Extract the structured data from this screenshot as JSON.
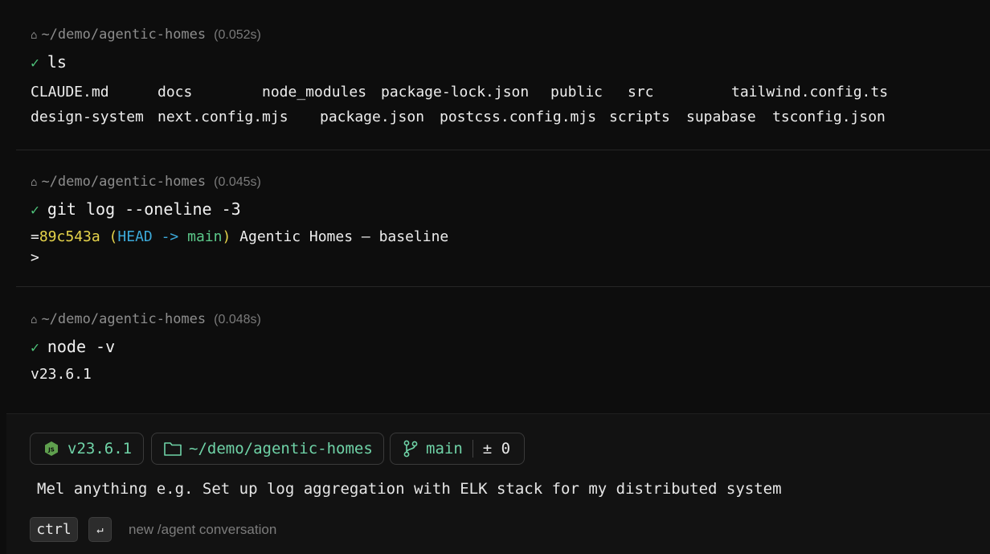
{
  "blocks": [
    {
      "path": "~/demo/agentic-homes",
      "time": "(0.052s)",
      "command": "ls",
      "ls_rows": [
        [
          "CLAUDE.md",
          "docs",
          "node_modules",
          "package-lock.json",
          "public",
          "src",
          "tailwind.config.ts"
        ],
        [
          "design-system",
          "next.config.mjs",
          "package.json",
          "postcss.config.mjs",
          "scripts",
          "supabase",
          "tsconfig.json"
        ]
      ]
    },
    {
      "path": "~/demo/agentic-homes",
      "time": "(0.045s)",
      "command": "git log --oneline -3",
      "git": {
        "prefix": "=",
        "hash": "89c543a",
        "open": "(",
        "head": "HEAD",
        "arrow": "->",
        "branch": "main",
        "close": ")",
        "message": "Agentic Homes — baseline",
        "next": ">"
      }
    },
    {
      "path": "~/demo/agentic-homes",
      "time": "(0.048s)",
      "command": "node -v",
      "output": "v23.6.1"
    }
  ],
  "status_chips": {
    "node_version": "v23.6.1",
    "cwd": "~/demo/agentic-homes",
    "branch": "main",
    "diff": "± 0"
  },
  "input": {
    "text": "Mel anything e.g. Set up log aggregation with ELK stack for my distributed system"
  },
  "shortcut": {
    "key1": "ctrl",
    "key2": "↵",
    "hint": "new /agent conversation"
  },
  "icons": {
    "home": "home-icon",
    "check": "check-icon",
    "node": "nodejs-icon",
    "folder": "folder-icon",
    "branch": "git-branch-icon"
  },
  "colors": {
    "check": "#4ec37a",
    "chip_text": "#6fd3a7",
    "hash": "#e6d44b",
    "head": "#3ca9d9",
    "branch": "#5cc98a"
  }
}
